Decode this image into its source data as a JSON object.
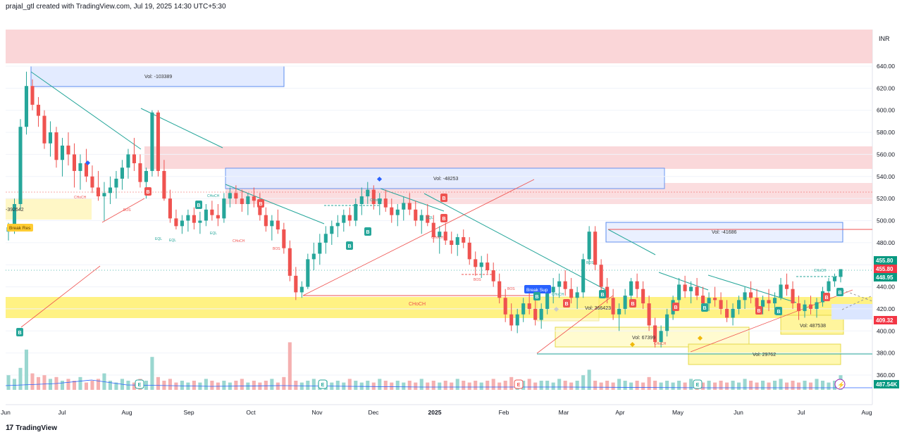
{
  "header": {
    "attribution": "prajal_gtl created with TradingView.com, Jul 19, 2025 14:30 UTC+5:30"
  },
  "footer": {
    "logo_glyph": "17",
    "brand": "TradingView"
  },
  "chart_data": {
    "type": "candlestick",
    "currency": "INR",
    "y_ticks": [
      360,
      380,
      400,
      420,
      440,
      460,
      480,
      500,
      520,
      540,
      560,
      580,
      600,
      620,
      640
    ],
    "y_tick_labels": [
      "360.00",
      "380.00",
      "400.00",
      "420.00",
      "440.00",
      "460.00",
      "480.00",
      "500.00",
      "520.00",
      "540.00",
      "560.00",
      "580.00",
      "600.00",
      "620.00",
      "640.00"
    ],
    "x_labels": [
      "Jun",
      "Jul",
      "Aug",
      "Sep",
      "Oct",
      "Nov",
      "Dec",
      "2025",
      "Feb",
      "Mar",
      "Apr",
      "May",
      "Jun",
      "Jul",
      "Aug"
    ],
    "price_badges": [
      {
        "value": 455.8,
        "label": "455.80",
        "color": "#089981"
      },
      {
        "value": 455.8,
        "label": "455.80",
        "color": "#f23645"
      },
      {
        "value": 448.95,
        "label": "448.95",
        "color": "#089981"
      },
      {
        "value": 409.32,
        "label": "409.32",
        "color": "#f23645"
      }
    ],
    "volume_badge": {
      "label": "487.54K",
      "color": "#089981"
    },
    "colors": {
      "up": "#26a69a",
      "down": "#ef5350",
      "supply_zone": "#f8d7da",
      "demand_zone": "#fff59d",
      "volume_box": "#e3ebff",
      "trendline_green": "#26a69a",
      "trendline_red": "#ef5350"
    },
    "zone_labels": [
      {
        "text": "Vol: -103389"
      },
      {
        "text": "Vol: -48253"
      },
      {
        "text": "Vol: -41686"
      },
      {
        "text": "Vol: 366423"
      },
      {
        "text": "Vol: 67399"
      },
      {
        "text": "Vol: 487538"
      },
      {
        "text": "Vol: 29762"
      },
      {
        "text": "-392642"
      }
    ],
    "structure_labels": [
      "CHoCH",
      "CHoCH",
      "CHoCH",
      "CHoCH",
      "CHoCH",
      "CHoCH",
      "CHoCH",
      "CHoCH",
      "CHoCH",
      "BOS",
      "BOS",
      "BOS",
      "BOS",
      "BOS",
      "EQL",
      "EQL",
      "EQL",
      "EQL"
    ],
    "signal_labels": {
      "break_res": "Break Res",
      "break_sup": "Break Sup",
      "buy": "B",
      "sell": "B",
      "earnings": "E"
    },
    "ohlc": [
      [
        490,
        498,
        482,
        494
      ],
      [
        494,
        520,
        488,
        515
      ],
      [
        515,
        592,
        510,
        585
      ],
      [
        585,
        635,
        578,
        622
      ],
      [
        622,
        628,
        600,
        605
      ],
      [
        605,
        612,
        585,
        595
      ],
      [
        595,
        600,
        565,
        570
      ],
      [
        570,
        590,
        558,
        580
      ],
      [
        580,
        585,
        548,
        555
      ],
      [
        555,
        575,
        540,
        568
      ],
      [
        568,
        580,
        550,
        560
      ],
      [
        560,
        570,
        530,
        545
      ],
      [
        545,
        560,
        528,
        552
      ],
      [
        552,
        565,
        535,
        540
      ],
      [
        540,
        550,
        525,
        530
      ],
      [
        530,
        545,
        518,
        522
      ],
      [
        522,
        535,
        500,
        525
      ],
      [
        525,
        540,
        515,
        530
      ],
      [
        530,
        545,
        520,
        538
      ],
      [
        538,
        555,
        528,
        548
      ],
      [
        548,
        565,
        538,
        560
      ],
      [
        560,
        575,
        545,
        552
      ],
      [
        552,
        560,
        530,
        535
      ],
      [
        535,
        548,
        520,
        545
      ],
      [
        545,
        600,
        540,
        598
      ],
      [
        598,
        600,
        540,
        545
      ],
      [
        545,
        555,
        518,
        520
      ],
      [
        520,
        528,
        498,
        502
      ],
      [
        502,
        510,
        492,
        495
      ],
      [
        495,
        505,
        488,
        500
      ],
      [
        500,
        510,
        490,
        505
      ],
      [
        505,
        512,
        492,
        498
      ],
      [
        498,
        508,
        488,
        500
      ],
      [
        500,
        515,
        495,
        510
      ],
      [
        510,
        518,
        500,
        505
      ],
      [
        505,
        515,
        495,
        502
      ],
      [
        502,
        525,
        498,
        520
      ],
      [
        520,
        530,
        512,
        525
      ],
      [
        525,
        532,
        515,
        520
      ],
      [
        520,
        528,
        508,
        515
      ],
      [
        515,
        525,
        505,
        522
      ],
      [
        522,
        530,
        512,
        518
      ],
      [
        518,
        525,
        500,
        505
      ],
      [
        505,
        512,
        490,
        495
      ],
      [
        495,
        505,
        482,
        500
      ],
      [
        500,
        510,
        488,
        492
      ],
      [
        492,
        498,
        470,
        475
      ],
      [
        475,
        482,
        445,
        450
      ],
      [
        450,
        458,
        428,
        435
      ],
      [
        435,
        445,
        430,
        440
      ],
      [
        440,
        470,
        438,
        465
      ],
      [
        465,
        480,
        455,
        470
      ],
      [
        470,
        488,
        460,
        480
      ],
      [
        480,
        495,
        470,
        488
      ],
      [
        488,
        500,
        478,
        495
      ],
      [
        495,
        505,
        485,
        498
      ],
      [
        498,
        510,
        490,
        505
      ],
      [
        505,
        512,
        495,
        500
      ],
      [
        500,
        520,
        495,
        515
      ],
      [
        515,
        530,
        505,
        522
      ],
      [
        522,
        535,
        515,
        528
      ],
      [
        528,
        532,
        510,
        515
      ],
      [
        515,
        525,
        505,
        520
      ],
      [
        520,
        528,
        508,
        512
      ],
      [
        512,
        520,
        498,
        505
      ],
      [
        505,
        515,
        495,
        510
      ],
      [
        510,
        522,
        500,
        516
      ],
      [
        516,
        525,
        505,
        510
      ],
      [
        510,
        518,
        495,
        500
      ],
      [
        500,
        510,
        488,
        505
      ],
      [
        505,
        515,
        495,
        498
      ],
      [
        498,
        505,
        480,
        485
      ],
      [
        485,
        495,
        470,
        490
      ],
      [
        490,
        498,
        478,
        482
      ],
      [
        482,
        490,
        470,
        478
      ],
      [
        478,
        488,
        468,
        485
      ],
      [
        485,
        492,
        475,
        480
      ],
      [
        480,
        485,
        460,
        465
      ],
      [
        465,
        472,
        450,
        458
      ],
      [
        458,
        468,
        448,
        462
      ],
      [
        462,
        470,
        452,
        455
      ],
      [
        455,
        462,
        440,
        445
      ],
      [
        445,
        452,
        425,
        430
      ],
      [
        430,
        438,
        408,
        415
      ],
      [
        415,
        425,
        400,
        405
      ],
      [
        405,
        420,
        398,
        415
      ],
      [
        415,
        430,
        408,
        425
      ],
      [
        425,
        435,
        415,
        420
      ],
      [
        420,
        428,
        405,
        410
      ],
      [
        410,
        425,
        402,
        420
      ],
      [
        420,
        440,
        415,
        435
      ],
      [
        435,
        448,
        425,
        440
      ],
      [
        440,
        452,
        430,
        445
      ],
      [
        445,
        455,
        432,
        438
      ],
      [
        438,
        448,
        425,
        430
      ],
      [
        430,
        440,
        420,
        435
      ],
      [
        435,
        470,
        430,
        465
      ],
      [
        465,
        495,
        460,
        490
      ],
      [
        490,
        495,
        455,
        460
      ],
      [
        460,
        465,
        435,
        440
      ],
      [
        440,
        448,
        425,
        430
      ],
      [
        430,
        438,
        410,
        415
      ],
      [
        415,
        425,
        400,
        420
      ],
      [
        420,
        438,
        415,
        432
      ],
      [
        432,
        448,
        428,
        445
      ],
      [
        445,
        452,
        430,
        438
      ],
      [
        438,
        445,
        420,
        425
      ],
      [
        425,
        432,
        400,
        405
      ],
      [
        405,
        412,
        385,
        390
      ],
      [
        390,
        405,
        385,
        400
      ],
      [
        400,
        420,
        395,
        415
      ],
      [
        415,
        432,
        410,
        428
      ],
      [
        428,
        448,
        422,
        442
      ],
      [
        442,
        450,
        430,
        436
      ],
      [
        436,
        445,
        425,
        440
      ],
      [
        440,
        448,
        428,
        432
      ],
      [
        432,
        440,
        420,
        425
      ],
      [
        425,
        435,
        418,
        430
      ],
      [
        430,
        440,
        422,
        428
      ],
      [
        428,
        435,
        415,
        420
      ],
      [
        420,
        428,
        408,
        412
      ],
      [
        412,
        425,
        405,
        420
      ],
      [
        420,
        432,
        415,
        428
      ],
      [
        428,
        440,
        420,
        435
      ],
      [
        435,
        445,
        425,
        430
      ],
      [
        430,
        438,
        418,
        422
      ],
      [
        422,
        432,
        415,
        428
      ],
      [
        428,
        438,
        418,
        425
      ],
      [
        425,
        435,
        415,
        430
      ],
      [
        430,
        448,
        428,
        442
      ],
      [
        442,
        452,
        432,
        438
      ],
      [
        438,
        445,
        420,
        425
      ],
      [
        425,
        432,
        410,
        418
      ],
      [
        418,
        428,
        412,
        424
      ],
      [
        424,
        432,
        415,
        420
      ],
      [
        420,
        430,
        412,
        426
      ],
      [
        426,
        440,
        422,
        436
      ],
      [
        436,
        448,
        430,
        445
      ],
      [
        445,
        452,
        440,
        449
      ],
      [
        449,
        456,
        444,
        456
      ]
    ],
    "volume": [
      8,
      6,
      12,
      22,
      9,
      7,
      8,
      6,
      7,
      5,
      6,
      5,
      7,
      4,
      5,
      6,
      9,
      5,
      4,
      6,
      5,
      4,
      6,
      5,
      18,
      7,
      5,
      6,
      4,
      5,
      4,
      5,
      4,
      6,
      5,
      4,
      5,
      4,
      5,
      6,
      4,
      5,
      4,
      5,
      6,
      4,
      7,
      26,
      5,
      4,
      5,
      6,
      4,
      5,
      4,
      5,
      4,
      6,
      5,
      4,
      5,
      4,
      6,
      5,
      4,
      5,
      4,
      5,
      4,
      6,
      4,
      5,
      4,
      5,
      4,
      6,
      5,
      4,
      5,
      4,
      5,
      6,
      4,
      5,
      7,
      4,
      5,
      6,
      4,
      5,
      5,
      4,
      6,
      5,
      4,
      5,
      8,
      11,
      5,
      4,
      5,
      4,
      6,
      5,
      4,
      5,
      4,
      7,
      5,
      4,
      5,
      4,
      5,
      4,
      6,
      5,
      4,
      5,
      4,
      5,
      4,
      5,
      4,
      6,
      5,
      4,
      5,
      4,
      5,
      6,
      4,
      5,
      4,
      5,
      4,
      6,
      5,
      4,
      5,
      8
    ]
  }
}
